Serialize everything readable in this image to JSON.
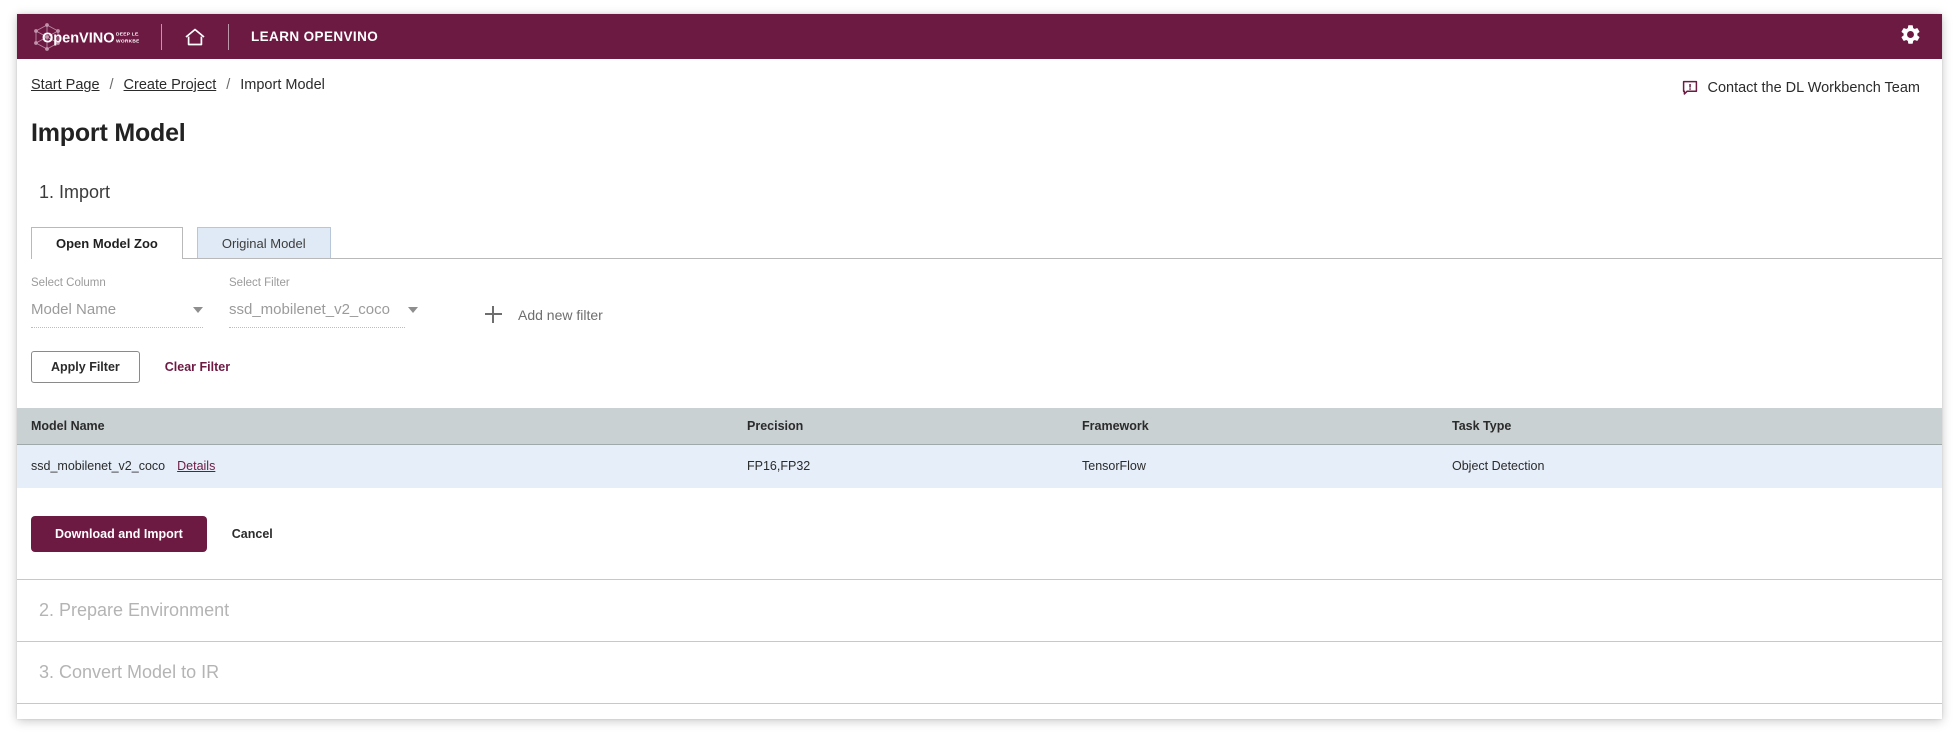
{
  "topbar": {
    "logo_name": "OpenVINO",
    "logo_sub_line1": "DEEP LEARNING",
    "logo_sub_line2": "WORKBENCH",
    "home_icon": "home-icon",
    "learn_link": "LEARN OPENVINO",
    "gear_icon": "gear-icon",
    "background_color": "#6d1a43"
  },
  "breadcrumb": {
    "items": [
      {
        "label": "Start Page",
        "is_link": true
      },
      {
        "label": "Create Project",
        "is_link": true
      },
      {
        "label": "Import Model",
        "is_link": false
      }
    ],
    "separator": "/"
  },
  "contact": {
    "icon": "feedback-bubble-icon",
    "label": "Contact the DL Workbench Team"
  },
  "page": {
    "title": "Import Model"
  },
  "steps": [
    {
      "number": "1",
      "label": "1. Import",
      "state": "active"
    },
    {
      "number": "2",
      "label": "2. Prepare Environment",
      "state": "disabled"
    },
    {
      "number": "3",
      "label": "3. Convert Model to IR",
      "state": "disabled"
    }
  ],
  "tabs": [
    {
      "label": "Open Model Zoo",
      "active": true
    },
    {
      "label": "Original Model",
      "active": false
    }
  ],
  "filters": {
    "column_select": {
      "label": "Select Column",
      "value": "Model Name",
      "caret_icon": "chevron-down-icon"
    },
    "filter_select": {
      "label": "Select Filter",
      "value": "ssd_mobilenet_v2_coco",
      "caret_icon": "chevron-down-icon"
    },
    "add_new_filter": {
      "icon": "plus-icon",
      "label": "Add new filter"
    },
    "apply_button": "Apply Filter",
    "clear_button": "Clear Filter"
  },
  "table": {
    "columns": [
      "Model Name",
      "Precision",
      "Framework",
      "Task Type"
    ],
    "rows": [
      {
        "model_name": "ssd_mobilenet_v2_coco",
        "details_link": "Details",
        "precision": "FP16,FP32",
        "framework": "TensorFlow",
        "task_type": "Object Detection",
        "selected": true
      }
    ]
  },
  "actions": {
    "primary": "Download and Import",
    "cancel": "Cancel"
  },
  "colors": {
    "brand": "#6d1a43",
    "table_header": "#c9d1d3",
    "row_selected": "#e5eef9",
    "tab_inactive": "#e0eaf6",
    "disabled_text": "#b4b4b4"
  }
}
